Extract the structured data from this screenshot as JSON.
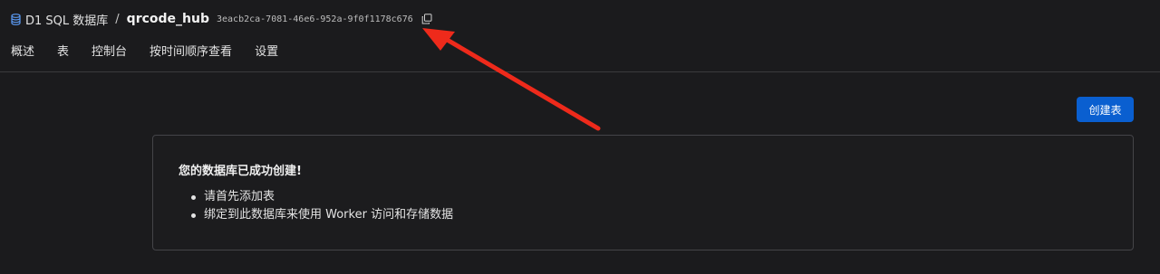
{
  "header": {
    "breadcrumb_root": "D1 SQL 数据库",
    "separator": "/",
    "database_name": "qrcode_hub",
    "database_id": "3eacb2ca-7081-46e6-952a-9f0f1178c676"
  },
  "tabs": [
    {
      "label": "概述"
    },
    {
      "label": "表"
    },
    {
      "label": "控制台"
    },
    {
      "label": "按时间顺序查看"
    },
    {
      "label": "设置"
    }
  ],
  "actions": {
    "create_table_label": "创建表"
  },
  "empty_state": {
    "title": "您的数据库已成功创建!",
    "items": [
      "请首先添加表",
      "绑定到此数据库来使用 Worker 访问和存储数据"
    ]
  },
  "colors": {
    "accent": "#0a5fd0",
    "annotation_arrow": "#ee2a1b",
    "db_icon": "#5b9bf5"
  },
  "icons": {
    "database": "database-icon",
    "copy": "copy-icon"
  }
}
